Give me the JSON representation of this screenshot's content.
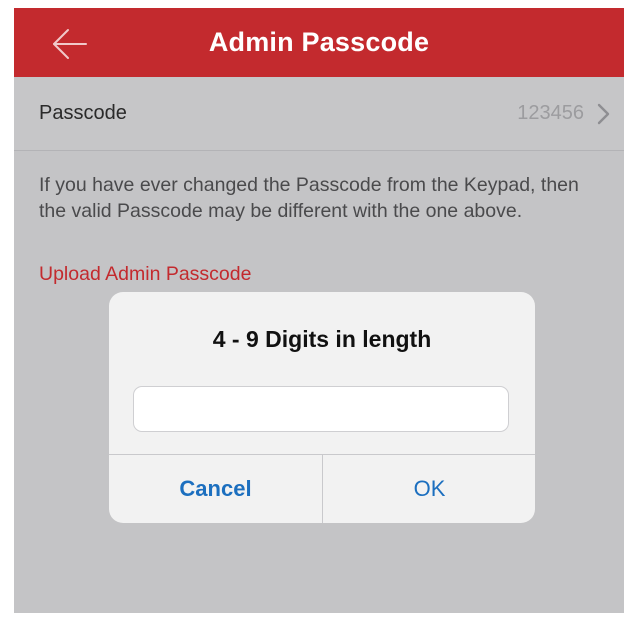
{
  "header": {
    "title": "Admin Passcode",
    "back_icon": "back-arrow-icon",
    "background_color": "#c32a2e"
  },
  "passcode_row": {
    "label": "Passcode",
    "value": "123456",
    "chevron_icon": "chevron-right-icon"
  },
  "info": {
    "text": "If you have ever changed the Passcode from the Keypad, then the valid Passcode may be different with the one above.",
    "link_text": "Upload Admin Passcode",
    "link_color": "#c32a2e"
  },
  "dialog": {
    "title": "4 - 9 Digits in length",
    "input_value": "",
    "cancel_label": "Cancel",
    "ok_label": "OK",
    "button_color": "#1c6fbf"
  }
}
